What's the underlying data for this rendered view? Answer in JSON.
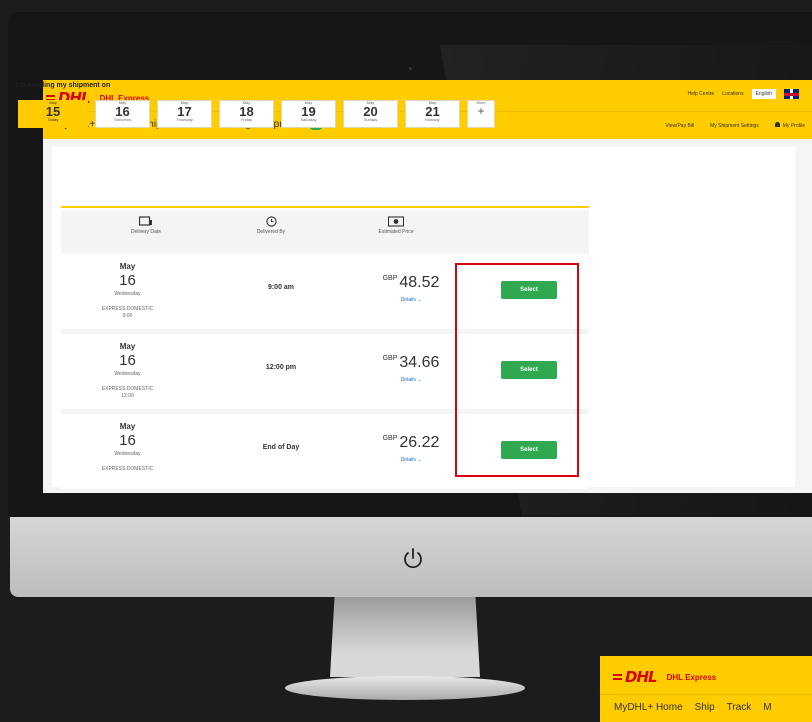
{
  "header": {
    "logo_text": "DHL",
    "brand": "DHL Express",
    "links": [
      "Help Centre",
      "Locations"
    ],
    "language": "English"
  },
  "nav": {
    "items": [
      "MyDHL+ Home",
      "Ship",
      "Track",
      "Manage Shipments"
    ],
    "shipments_count": "13",
    "right_items": [
      "View/Pay Bill",
      "My Shipment Settings",
      "My Profile"
    ]
  },
  "page": {
    "heading": "I'm sending my shipment on"
  },
  "dates": [
    {
      "month": "May",
      "day": "15",
      "label": "Today",
      "active": true
    },
    {
      "month": "May",
      "day": "16",
      "label": "Tomorrow"
    },
    {
      "month": "May",
      "day": "17",
      "label": "Thursday"
    },
    {
      "month": "May",
      "day": "18",
      "label": "Friday"
    },
    {
      "month": "May",
      "day": "19",
      "label": "Saturday"
    },
    {
      "month": "May",
      "day": "20",
      "label": "Sunday"
    },
    {
      "month": "May",
      "day": "21",
      "label": "Monday"
    }
  ],
  "more_tab": {
    "label": "More",
    "symbol": "+"
  },
  "columns": [
    "Delivery Date",
    "Delivered By",
    "Estimated Price"
  ],
  "rows": [
    {
      "month": "May",
      "day": "16",
      "weekday": "Wednesday",
      "product": "EXPRESS DOMESTIC",
      "product_time": "9:00",
      "delivered_by": "9:00 am",
      "currency": "GBP",
      "price": "48.52",
      "details": "Details ⌄",
      "select": "Select"
    },
    {
      "month": "May",
      "day": "16",
      "weekday": "Wednesday",
      "product": "EXPRESS DOMESTIC",
      "product_time": "12:00",
      "delivered_by": "12:00 pm",
      "currency": "GBP",
      "price": "34.66",
      "details": "Details ⌄",
      "select": "Select"
    },
    {
      "month": "May",
      "day": "16",
      "weekday": "Wednesday",
      "product": "EXPRESS DOMESTIC",
      "product_time": "",
      "delivered_by": "End of Day",
      "currency": "GBP",
      "price": "26.22",
      "details": "Details ⌄",
      "select": "Select"
    }
  ],
  "mini": {
    "brand": "DHL Express",
    "nav": [
      "MyDHL+ Home",
      "Ship",
      "Track",
      "M"
    ]
  },
  "colors": {
    "brand_yellow": "#ffcc00",
    "brand_red": "#d40511",
    "select_green": "#2fa84f"
  }
}
